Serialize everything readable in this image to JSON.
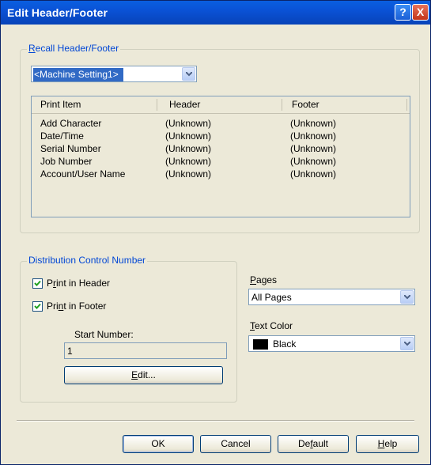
{
  "window": {
    "title": "Edit Header/Footer",
    "help_glyph": "?",
    "close_glyph": "X"
  },
  "recall": {
    "group_label": "Recall Header/Footer",
    "selected": "<Machine Setting1>",
    "columns": [
      "Print Item",
      "Header",
      "Footer"
    ],
    "rows": [
      [
        "Add Character",
        "(Unknown)",
        "(Unknown)"
      ],
      [
        "Date/Time",
        "(Unknown)",
        "(Unknown)"
      ],
      [
        "Serial Number",
        "(Unknown)",
        "(Unknown)"
      ],
      [
        "Job Number",
        "(Unknown)",
        "(Unknown)"
      ],
      [
        "Account/User Name",
        "(Unknown)",
        "(Unknown)"
      ]
    ]
  },
  "distribution": {
    "group_label": "Distribution Control Number",
    "print_in_header": {
      "label_pre": "P",
      "label_u": "r",
      "label_post": "int in Header",
      "checked": true
    },
    "print_in_footer": {
      "label_pre": "Pri",
      "label_u": "n",
      "label_post": "t in Footer",
      "checked": true
    },
    "start_number_label": "Start Number:",
    "start_number_value": "1",
    "edit_button": {
      "u": "E",
      "rest": "dit..."
    }
  },
  "pages": {
    "label_u": "P",
    "label_rest": "ages",
    "selected": "All Pages"
  },
  "text_color": {
    "label_u": "T",
    "label_rest": "ext Color",
    "selected": "Black",
    "swatch_color": "#000000"
  },
  "footer_buttons": {
    "ok": "OK",
    "cancel": "Cancel",
    "default": {
      "pre": "De",
      "u": "f",
      "post": "ault"
    },
    "help": {
      "u": "H",
      "rest": "elp"
    }
  }
}
